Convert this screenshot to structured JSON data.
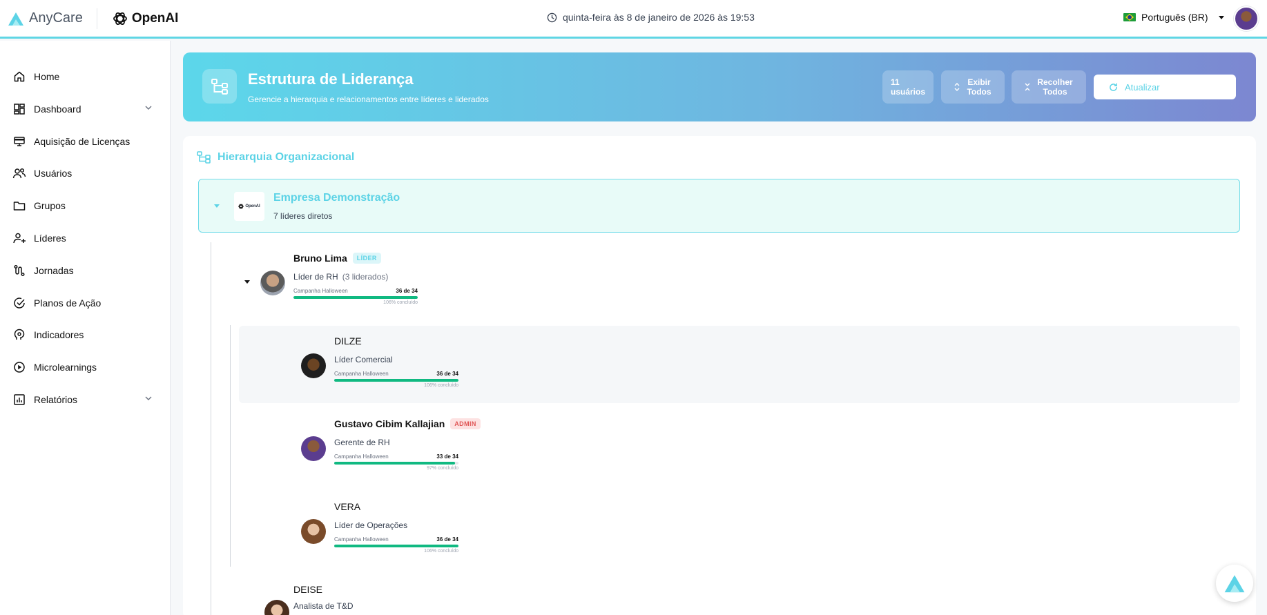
{
  "topbar": {
    "brand_anycare": "AnyCare",
    "brand_openai": "OpenAI",
    "datetime": "quinta-feira às 8 de janeiro de 2026 às 19:53",
    "language": "Português (BR)"
  },
  "sidebar": {
    "items": [
      {
        "label": "Home",
        "icon": "home-icon"
      },
      {
        "label": "Dashboard",
        "icon": "dashboard-icon",
        "expandable": true
      },
      {
        "label": "Aquisição de Licenças",
        "icon": "license-icon"
      },
      {
        "label": "Usuários",
        "icon": "users-icon"
      },
      {
        "label": "Grupos",
        "icon": "folder-icon"
      },
      {
        "label": "Líderes",
        "icon": "leader-icon"
      },
      {
        "label": "Jornadas",
        "icon": "journey-icon"
      },
      {
        "label": "Planos de Ação",
        "icon": "check-circle-icon"
      },
      {
        "label": "Indicadores",
        "icon": "indicator-icon"
      },
      {
        "label": "Microlearnings",
        "icon": "play-circle-icon"
      },
      {
        "label": "Relatórios",
        "icon": "report-icon",
        "expandable": true
      }
    ]
  },
  "hero": {
    "title": "Estrutura de Liderança",
    "subtitle": "Gerencie a hierarquia e relacionamentos entre líderes e liderados",
    "users_count": "11",
    "users_label": "usuários",
    "expand_line1": "Exibir",
    "expand_line2": "Todos",
    "collapse_line1": "Recolher",
    "collapse_line2": "Todos",
    "refresh_label": "Atualizar"
  },
  "hierarchy": {
    "title": "Hierarquia Organizacional",
    "root": {
      "name": "Empresa Demonstração",
      "subtitle": "7 líderes diretos",
      "logo_text": "OpenAI"
    },
    "people": [
      {
        "name": "Bruno Lima",
        "badge": "LÍDER",
        "role": "Líder de RH",
        "extra": "(3 liderados)",
        "campaign": "Campanha Halloween",
        "count": "36 de 34",
        "progress": 1.0,
        "pct_label": "106% concluído"
      },
      {
        "name": "DILZE",
        "badge": "",
        "role": "Líder Comercial",
        "extra": "",
        "campaign": "Campanha Halloween",
        "count": "36 de 34",
        "progress": 1.0,
        "pct_label": "106% concluído"
      },
      {
        "name": "Gustavo Cibim Kallajian",
        "badge": "ADMIN",
        "role": "Gerente de RH",
        "extra": "",
        "campaign": "Campanha Halloween",
        "count": "33 de 34",
        "progress": 0.97,
        "pct_label": "97% concluído"
      },
      {
        "name": "VERA",
        "badge": "",
        "role": "Líder de Operações",
        "extra": "",
        "campaign": "Campanha Halloween",
        "count": "36 de 34",
        "progress": 1.0,
        "pct_label": "106% concluído"
      },
      {
        "name": "DEISE",
        "badge": "",
        "role": "Analista de T&D",
        "extra": ""
      }
    ]
  },
  "colors": {
    "accent": "#5cd3e6",
    "progress": "#10b981",
    "admin": "#e05656"
  }
}
